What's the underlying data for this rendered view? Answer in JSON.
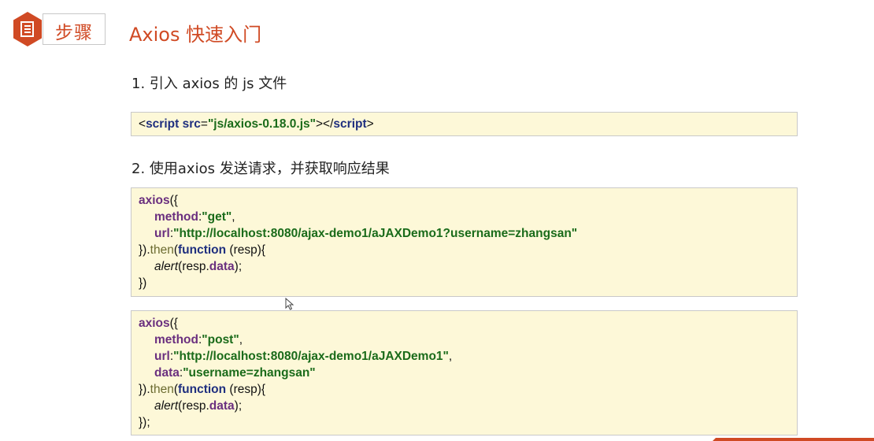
{
  "header": {
    "icon": "document-icon",
    "step_label": "步骤",
    "title": "Axios 快速入门"
  },
  "step1": {
    "heading": "1. 引入 axios 的 js 文件",
    "code": {
      "lt": "<",
      "tag_open": "script",
      "space": " ",
      "attr": "src",
      "eq": "=",
      "value": "\"js/axios-0.18.0.js\"",
      "close_open": "></",
      "tag_close": "script",
      "gt": ">"
    }
  },
  "step2": {
    "heading": "2. 使用axios 发送请求，并获取响应结果"
  },
  "code_get": {
    "axios": "axios",
    "open": "({",
    "method_key": "method",
    "colon": ":",
    "method_value": "\"get\"",
    "comma": ",",
    "url_key": "url",
    "url_value": "\"http://localhost:8080/ajax-demo1/aJAXDemo1?username=zhangsan\"",
    "close_then": "}).",
    "then": "then",
    "paren_open": "(",
    "function": "function",
    "args": " (resp){",
    "alert": "alert",
    "alert_arg_open": "(resp.",
    "data": "data",
    "alert_close": ");",
    "end": "})"
  },
  "code_post": {
    "axios": "axios",
    "open": "({",
    "method_key": "method",
    "colon": ":",
    "method_value": "\"post\"",
    "comma": ",",
    "url_key": "url",
    "url_value": "\"http://localhost:8080/ajax-demo1/aJAXDemo1\"",
    "data_key": "data",
    "data_value": "\"username=zhangsan\"",
    "close_then": "}).",
    "then": "then",
    "paren_open": "(",
    "function": "function",
    "args": " (resp){",
    "alert": "alert",
    "alert_arg_open": "(resp.",
    "data": "data",
    "alert_close": ");",
    "end": "});"
  },
  "colors": {
    "accent": "#d04a24",
    "code_bg": "#fdf8d8",
    "keyword": "#1f2f7f",
    "property": "#6a2f7f",
    "string": "#1a6b1a"
  }
}
